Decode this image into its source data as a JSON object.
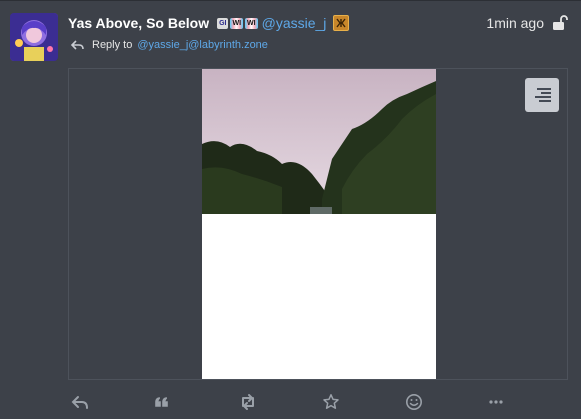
{
  "post": {
    "display_name": "Yas Above, So Below",
    "emoji_badges": [
      "GI",
      "WI",
      "WI"
    ],
    "handle": "@yassie_j",
    "badge_icon": "bot-badge-icon",
    "timestamp": "1min ago",
    "visibility_icon": "unlocked-lock-icon",
    "reply_prefix": "Reply to",
    "reply_target": "@yassie_j@labyrinth.zone"
  },
  "media": {
    "type": "image",
    "menu_icon": "align-right-icon"
  },
  "actions": [
    {
      "name": "reply-button",
      "icon": "reply-icon"
    },
    {
      "name": "quote-button",
      "icon": "quote-icon"
    },
    {
      "name": "boost-button",
      "icon": "retweet-icon"
    },
    {
      "name": "favorite-button",
      "icon": "star-icon"
    },
    {
      "name": "react-button",
      "icon": "smile-icon"
    },
    {
      "name": "more-button",
      "icon": "ellipsis-icon"
    }
  ],
  "colors": {
    "background": "#3d4149",
    "link": "#5ea8e8",
    "text": "#e6e6e6"
  }
}
